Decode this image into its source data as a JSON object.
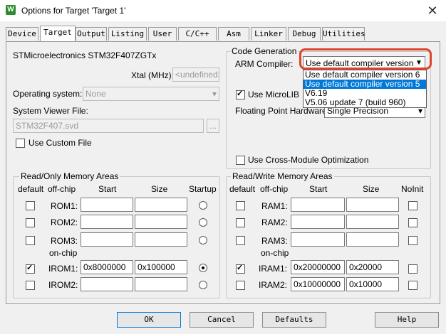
{
  "window": {
    "title": "Options for Target 'Target 1'",
    "app_icon_letter": "W"
  },
  "tabs": [
    "Device",
    "Target",
    "Output",
    "Listing",
    "User",
    "C/C++",
    "Asm",
    "Linker",
    "Debug",
    "Utilities"
  ],
  "device": {
    "name": "STMicroelectronics STM32F407ZGTx"
  },
  "xtal": {
    "label": "Xtal (MHz):",
    "value": "<undefined>"
  },
  "os": {
    "label": "Operating system:",
    "value": "None"
  },
  "svf": {
    "label": "System Viewer File:",
    "value": "STM32F407.svd",
    "browse": "..."
  },
  "use_custom_file": {
    "label": "Use Custom File",
    "checked": false
  },
  "codegen": {
    "group_label": "Code Generation",
    "compiler_label": "ARM Compiler:",
    "compiler_value": "Use default compiler version 5",
    "options": [
      "Use default compiler version 6",
      "Use default compiler version 5",
      "V6.19",
      "V5.06 update 7 (build 960)"
    ],
    "selected_index": 1,
    "microlib_label": "Use MicroLIB",
    "fp_label": "Floating Point Hardware:",
    "fp_value": "Single Precision",
    "cross_module_label": "Use Cross-Module Optimization"
  },
  "ro_mem": {
    "group_label": "Read/Only Memory Areas",
    "headers": {
      "default": "default",
      "offchip": "off-chip",
      "start": "Start",
      "size": "Size",
      "last": "Startup"
    },
    "onchip_label": "on-chip",
    "rows": [
      {
        "name": "ROM1:",
        "start": "",
        "size": "",
        "default": false,
        "radio": false
      },
      {
        "name": "ROM2:",
        "start": "",
        "size": "",
        "default": false,
        "radio": false
      },
      {
        "name": "ROM3:",
        "start": "",
        "size": "",
        "default": false,
        "radio": false
      },
      {
        "name": "IROM1:",
        "start": "0x8000000",
        "size": "0x100000",
        "default": true,
        "radio": true
      },
      {
        "name": "IROM2:",
        "start": "",
        "size": "",
        "default": false,
        "radio": false
      }
    ]
  },
  "rw_mem": {
    "group_label": "Read/Write Memory Areas",
    "headers": {
      "default": "default",
      "offchip": "off-chip",
      "start": "Start",
      "size": "Size",
      "last": "NoInit"
    },
    "onchip_label": "on-chip",
    "rows": [
      {
        "name": "RAM1:",
        "start": "",
        "size": "",
        "default": false,
        "noinit": false
      },
      {
        "name": "RAM2:",
        "start": "",
        "size": "",
        "default": false,
        "noinit": false
      },
      {
        "name": "RAM3:",
        "start": "",
        "size": "",
        "default": false,
        "noinit": false
      },
      {
        "name": "IRAM1:",
        "start": "0x20000000",
        "size": "0x20000",
        "default": true,
        "noinit": false
      },
      {
        "name": "IRAM2:",
        "start": "0x10000000",
        "size": "0x10000",
        "default": false,
        "noinit": false
      }
    ]
  },
  "buttons": {
    "ok": "OK",
    "cancel": "Cancel",
    "defaults": "Defaults",
    "help": "Help"
  }
}
